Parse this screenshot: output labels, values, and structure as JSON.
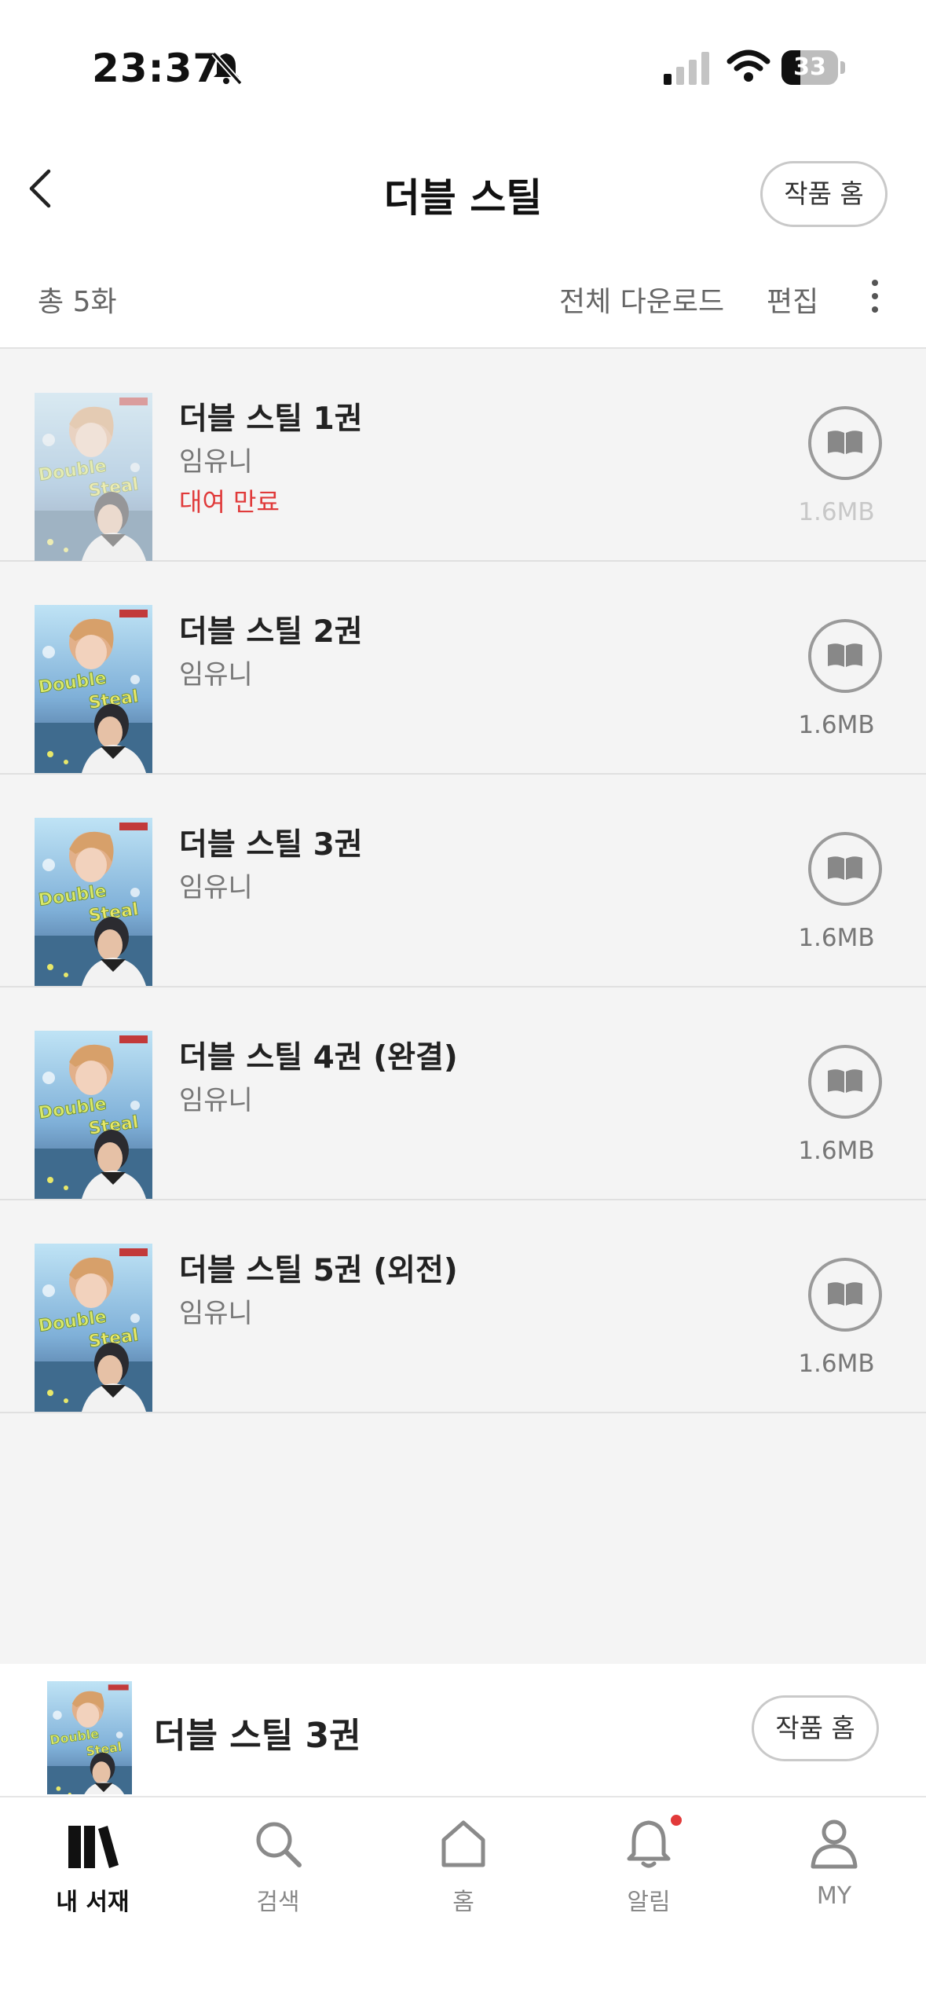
{
  "status_bar": {
    "time": "23:37",
    "battery": "33",
    "battery_level": 0.33
  },
  "header": {
    "title": "더블 스틸",
    "work_home_button": "작품 홈"
  },
  "toolbar": {
    "count": "총 5화",
    "download_all": "전체 다운로드",
    "edit": "편집"
  },
  "episodes": [
    {
      "title": "더블 스틸 1권",
      "author": "임유니",
      "status": "대여 만료",
      "size": "1.6MB",
      "expired": true
    },
    {
      "title": "더블 스틸 2권",
      "author": "임유니",
      "status": "",
      "size": "1.6MB",
      "expired": false
    },
    {
      "title": "더블 스틸 3권",
      "author": "임유니",
      "status": "",
      "size": "1.6MB",
      "expired": false
    },
    {
      "title": "더블 스틸 4권 (완결)",
      "author": "임유니",
      "status": "",
      "size": "1.6MB",
      "expired": false
    },
    {
      "title": "더블 스틸 5권 (외전)",
      "author": "임유니",
      "status": "",
      "size": "1.6MB",
      "expired": false
    }
  ],
  "mini_player": {
    "title": "더블 스틸 3권",
    "work_home_button": "작품 홈"
  },
  "tabs": [
    {
      "label": "내 서재",
      "icon": "library-icon",
      "active": true
    },
    {
      "label": "검색",
      "icon": "search-icon",
      "active": false
    },
    {
      "label": "홈",
      "icon": "home-icon",
      "active": false
    },
    {
      "label": "알림",
      "icon": "bell-icon",
      "active": false,
      "badge": true
    },
    {
      "label": "MY",
      "icon": "profile-icon",
      "active": false
    }
  ],
  "colors": {
    "accent_red": "#e03a3a",
    "background": "#f4f4f4"
  }
}
